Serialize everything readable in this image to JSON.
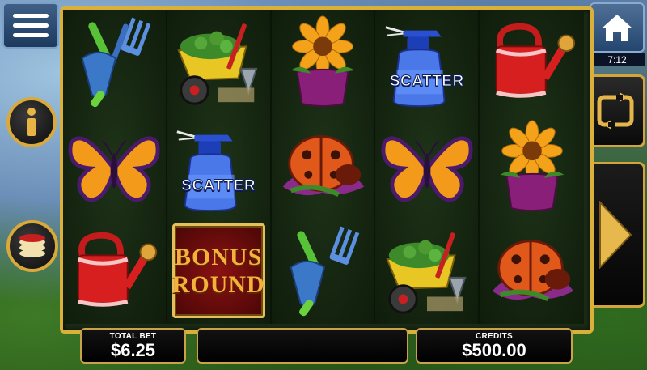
{
  "bottom_bar": {
    "total_bet_label": "TOTAL BET",
    "total_bet_value": "$6.25",
    "credits_label": "CREDITS",
    "credits_value": "$500.00",
    "message": ""
  },
  "clock": "7:12",
  "icons": {
    "menu": "menu-icon",
    "info": "info-icon",
    "bet": "coin-stack-icon",
    "home": "home-icon",
    "autoplay": "autoplay-icon",
    "spin": "spin-arrow-icon"
  },
  "reels": [
    [
      "garden-trowel-fork",
      "butterfly",
      "watering-can"
    ],
    [
      "wheelbarrow",
      "spray-bottle-scatter",
      "bonus-round"
    ],
    [
      "sunflower-pot",
      "ladybug",
      "garden-trowel-fork"
    ],
    [
      "spray-bottle-scatter",
      "butterfly",
      "wheelbarrow"
    ],
    [
      "watering-can",
      "sunflower-pot",
      "ladybug"
    ]
  ],
  "symbol_text": {
    "scatter": "SCATTER",
    "bonus_line1": "BONUS",
    "bonus_line2": "ROUND"
  },
  "colors": {
    "frame_gold": "#d9b13a",
    "bonus_red": "#8a1212",
    "bonus_text": "#f3b23a"
  }
}
